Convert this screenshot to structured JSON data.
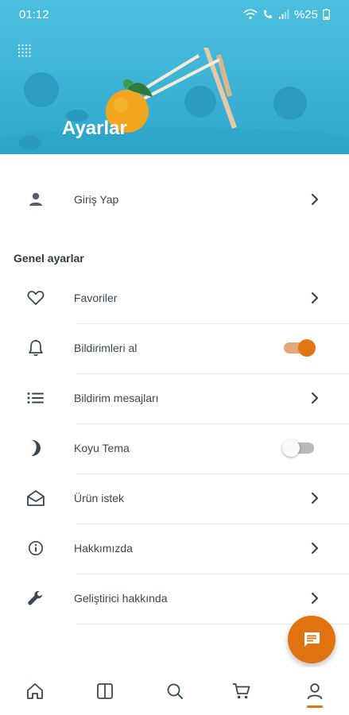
{
  "status_bar": {
    "time": "01:12",
    "battery": "%25",
    "icons": [
      "wifi-icon",
      "volte-call-icon",
      "signal-icon",
      "battery-icon"
    ]
  },
  "header": {
    "title": "Ayarlar",
    "icon": "grid-dots-icon"
  },
  "account": {
    "login_label": "Giriş Yap",
    "icon": "person-icon"
  },
  "general_settings": {
    "title": "Genel ayarlar",
    "items": [
      {
        "label": "Favoriler",
        "icon": "heart-outline-icon",
        "control": "chevron"
      },
      {
        "label": "Bildirimleri al",
        "icon": "bell-icon",
        "control": "toggle",
        "toggle_on": true
      },
      {
        "label": "Bildirim mesajları",
        "icon": "list-icon",
        "control": "chevron"
      },
      {
        "label": "Koyu Tema",
        "icon": "moon-icon",
        "control": "toggle",
        "toggle_on": false
      },
      {
        "label": "Ürün istek",
        "icon": "mail-open-icon",
        "control": "chevron"
      },
      {
        "label": "Hakkımızda",
        "icon": "info-icon",
        "control": "chevron"
      },
      {
        "label": "Geliştirici hakkında",
        "icon": "wrench-icon",
        "control": "chevron"
      }
    ]
  },
  "fab": {
    "icon": "chat-icon"
  },
  "bottom_nav": {
    "items": [
      "home-icon",
      "book-icon",
      "search-icon",
      "cart-icon",
      "profile-icon"
    ],
    "active": "profile-icon"
  },
  "colors": {
    "accent": "#e0720f",
    "header_bg": "#3cb3d6",
    "text": "#3b4754",
    "toggle_track_on": "#e6a77b",
    "toggle_track_off": "#b9b9b9"
  }
}
